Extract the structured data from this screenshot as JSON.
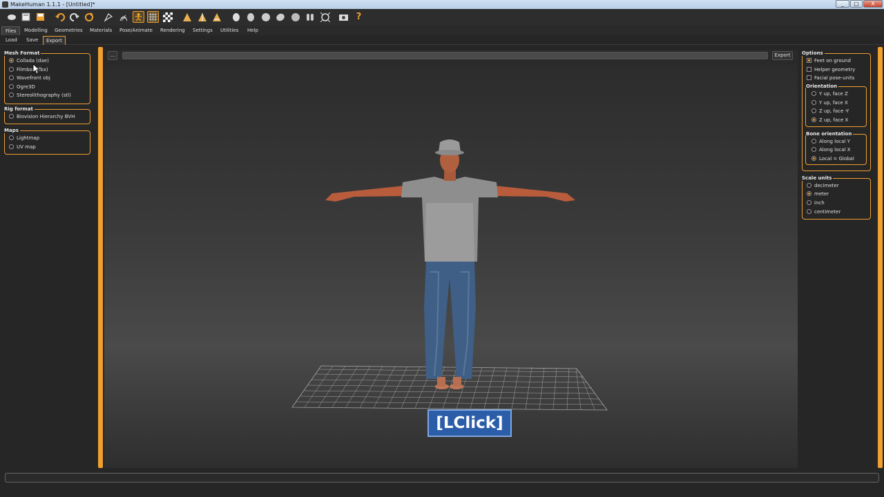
{
  "window": {
    "title": "MakeHuman 1.1.1 - [Untitled]*",
    "controls": [
      "_",
      "□",
      "X"
    ]
  },
  "toolbar": {
    "icons": [
      "smooth-icon",
      "new-icon",
      "save-icon",
      "undo-icon",
      "redo-icon",
      "reset-icon",
      "pose-icon",
      "wireframe-icon",
      "skeleton-icon",
      "grid-icon",
      "checker-icon",
      "front-view-icon",
      "side-view-icon",
      "back-view-icon",
      "head-front-icon",
      "head-side-icon",
      "head-top-icon",
      "head-left-icon",
      "head-right-icon",
      "head-back-icon",
      "reset-camera-icon",
      "screenshot-icon",
      "help-icon"
    ]
  },
  "tabs": [
    "Files",
    "Modelling",
    "Geometries",
    "Materials",
    "Pose/Animate",
    "Rendering",
    "Settings",
    "Utilities",
    "Help"
  ],
  "active_tab": "Files",
  "subtabs": [
    "Load",
    "Save",
    "Export"
  ],
  "active_subtab": "Export",
  "left": {
    "mesh_format": {
      "title": "Mesh Format",
      "options": [
        "Collada (dae)",
        "Filmbox (fbx)",
        "Wavefront obj",
        "Ogre3D",
        "Stereolithography (stl)"
      ],
      "selected": 0
    },
    "rig_format": {
      "title": "Rig format",
      "options": [
        "Biovision Hierarchy BVH"
      ],
      "selected": -1
    },
    "maps": {
      "title": "Maps",
      "options": [
        "Lightmap",
        "UV map"
      ],
      "selected": -1
    }
  },
  "path": {
    "browse_label": "...",
    "value": "",
    "export_label": "Export"
  },
  "right": {
    "options": {
      "title": "Options",
      "checks": [
        {
          "label": "Feet on ground",
          "checked": true
        },
        {
          "label": "Helper geometry",
          "checked": false
        },
        {
          "label": "Facial pose-units",
          "checked": false
        }
      ]
    },
    "orientation": {
      "title": "Orientation",
      "options": [
        "Y up, face Z",
        "Y up, face X",
        "Z up, face -Y",
        "Z up, face X"
      ],
      "selected": 3
    },
    "bone_orientation": {
      "title": "Bone orientation",
      "options": [
        "Along local Y",
        "Along local X",
        "Local = Global"
      ],
      "selected": 2
    },
    "scale_units": {
      "title": "Scale units",
      "options": [
        "decimeter",
        "meter",
        "inch",
        "centimeter"
      ],
      "selected": 1
    }
  },
  "overlay": {
    "lclick": "[LClick]"
  },
  "colors": {
    "accent": "#f0a030",
    "panel": "#262626",
    "lclick_bg": "#2c5da8"
  }
}
